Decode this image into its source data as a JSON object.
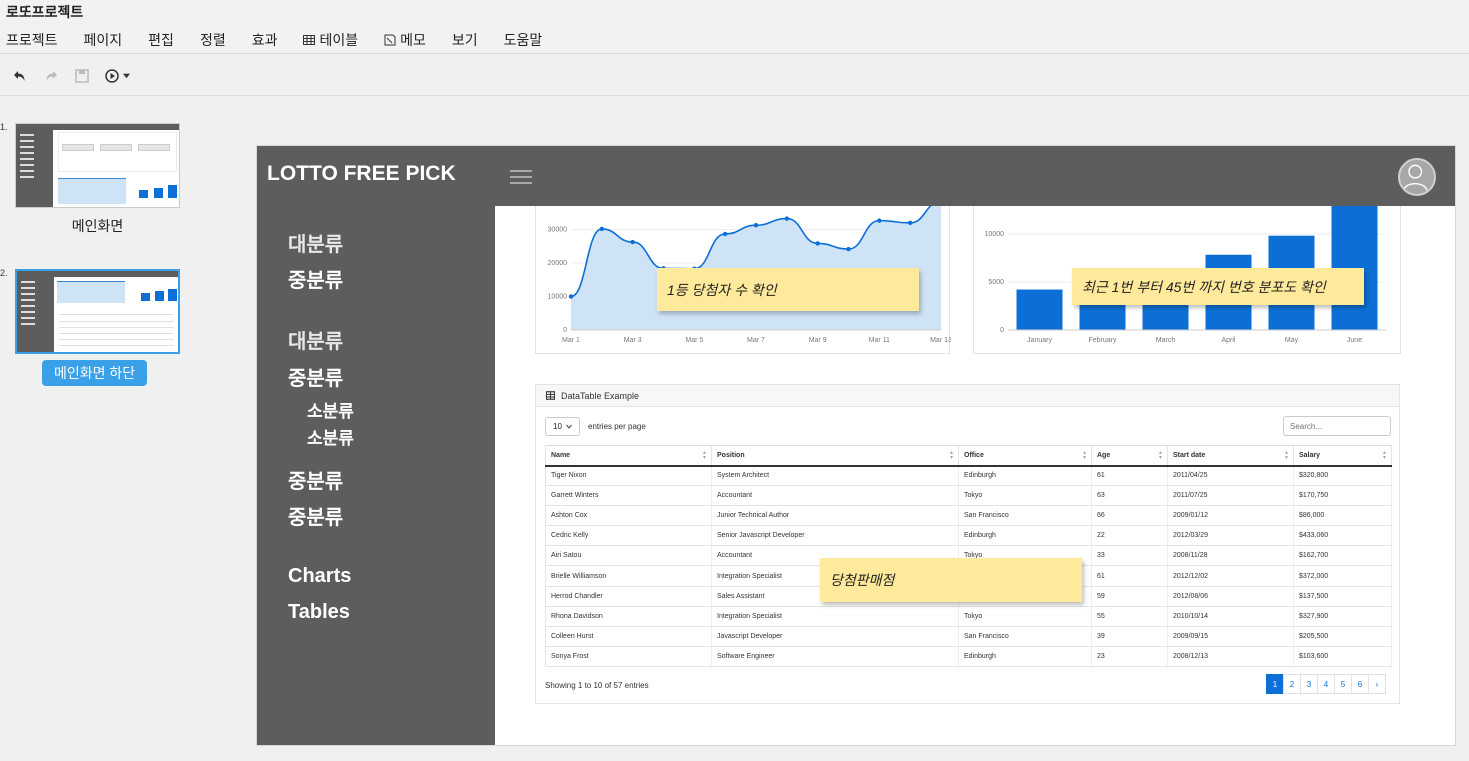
{
  "app": {
    "title": "로또프로젝트"
  },
  "menu": [
    {
      "label": "프로젝트",
      "icon": ""
    },
    {
      "label": "페이지",
      "icon": ""
    },
    {
      "label": "편집",
      "icon": ""
    },
    {
      "label": "정렬",
      "icon": ""
    },
    {
      "label": "효과",
      "icon": ""
    },
    {
      "label": "테이블",
      "icon": "table-icon"
    },
    {
      "label": "메모",
      "icon": "memo-icon"
    },
    {
      "label": "보기",
      "icon": ""
    },
    {
      "label": "도움말",
      "icon": ""
    }
  ],
  "toolbar": {
    "icons": [
      "undo-icon",
      "redo-icon",
      "save-icon",
      "play-icon",
      "dropdown-caret-icon"
    ]
  },
  "pages": [
    {
      "number": "1.",
      "label": "메인화면",
      "selected": false
    },
    {
      "number": "2.",
      "label": "메인화면 하단",
      "selected": true
    }
  ],
  "canvas": {
    "brand": "LOTTO FREE PICK",
    "sidenav": {
      "items": [
        "대분류",
        "중분류",
        "대분류",
        "중분류",
        "소분류",
        "소분류",
        "중분류",
        "중분류",
        "Charts",
        "Tables"
      ]
    }
  },
  "area_chart": {
    "type": "area",
    "x_labels": [
      "Mar 1",
      "Mar 3",
      "Mar 5",
      "Mar 7",
      "Mar 9",
      "Mar 11",
      "Mar 13"
    ],
    "y_ticks": [
      "0",
      "10000",
      "20000",
      "30000"
    ],
    "values": [
      10000,
      30162,
      26263,
      18394,
      18287,
      28682,
      31274,
      33259,
      25849,
      24159,
      32651,
      31984,
      38451
    ],
    "ylim": [
      0,
      40000
    ],
    "color": "#0c6fd6",
    "fill": "#cfe3f6"
  },
  "bar_chart": {
    "type": "bar",
    "categories": [
      "January",
      "February",
      "March",
      "April",
      "May",
      "June"
    ],
    "y_ticks": [
      "0",
      "5000",
      "10000"
    ],
    "values": [
      4215,
      5312,
      6251,
      7841,
      9821,
      14984
    ],
    "ylim": [
      0,
      10000
    ],
    "color": "#0c6fd6"
  },
  "notes": {
    "winners": "1등 당첨자 수 확인",
    "distribution": "최근 1번 부터 45번 까지  번호 분포도 확인",
    "stores": "당첨판매점"
  },
  "datatable": {
    "title": "DataTable Example",
    "length_value": "10",
    "length_suffix": "entries per page",
    "search_placeholder": "Search...",
    "columns": [
      "Name",
      "Position",
      "Office",
      "Age",
      "Start date",
      "Salary"
    ],
    "rows": [
      [
        "Tiger Nixon",
        "System Architect",
        "Edinburgh",
        "61",
        "2011/04/25",
        "$320,800"
      ],
      [
        "Garrett Winters",
        "Accountant",
        "Tokyo",
        "63",
        "2011/07/25",
        "$170,750"
      ],
      [
        "Ashton Cox",
        "Junior Technical Author",
        "San Francisco",
        "66",
        "2009/01/12",
        "$86,000"
      ],
      [
        "Cedric Kelly",
        "Senior Javascript Developer",
        "Edinburgh",
        "22",
        "2012/03/29",
        "$433,060"
      ],
      [
        "Airi Satou",
        "Accountant",
        "Tokyo",
        "33",
        "2008/11/28",
        "$162,700"
      ],
      [
        "Brielle Williamson",
        "Integration Specialist",
        "",
        "61",
        "2012/12/02",
        "$372,000"
      ],
      [
        "Herrod Chandler",
        "Sales Assistant",
        "",
        "59",
        "2012/08/06",
        "$137,500"
      ],
      [
        "Rhona Davidson",
        "Integration Specialist",
        "Tokyo",
        "55",
        "2010/10/14",
        "$327,900"
      ],
      [
        "Colleen Hurst",
        "Javascript Developer",
        "San Francisco",
        "39",
        "2009/09/15",
        "$205,500"
      ],
      [
        "Sonya Frost",
        "Software Engineer",
        "Edinburgh",
        "23",
        "2008/12/13",
        "$103,600"
      ]
    ],
    "info": "Showing 1 to 10 of 57 entries",
    "pages": [
      "1",
      "2",
      "3",
      "4",
      "5",
      "6",
      "›"
    ],
    "active_page": "1"
  }
}
